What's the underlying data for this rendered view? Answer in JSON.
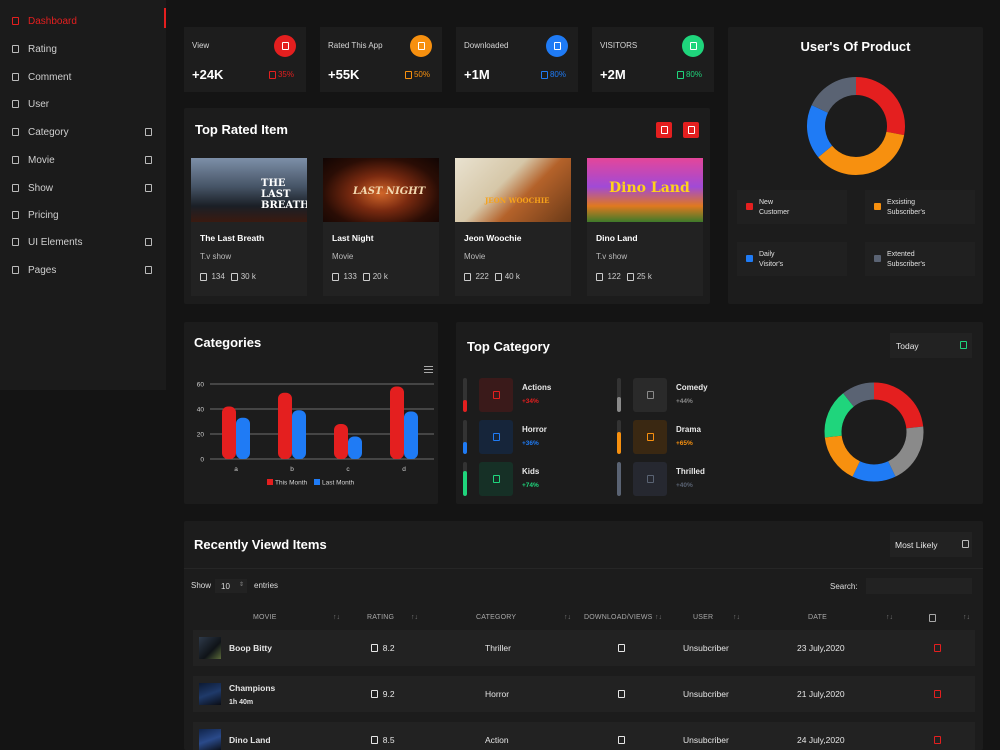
{
  "sidebar": {
    "items": [
      {
        "label": "Dashboard",
        "active": true,
        "arrow": false
      },
      {
        "label": "Rating",
        "arrow": false
      },
      {
        "label": "Comment",
        "arrow": false
      },
      {
        "label": "User",
        "arrow": false
      },
      {
        "label": "Category",
        "arrow": true
      },
      {
        "label": "Movie",
        "arrow": true
      },
      {
        "label": "Show",
        "arrow": true
      },
      {
        "label": "Pricing",
        "arrow": false
      },
      {
        "label": "UI Elements",
        "arrow": true
      },
      {
        "label": "Pages",
        "arrow": true
      }
    ]
  },
  "stats": [
    {
      "name": "View",
      "value": "+24K",
      "pct": "35%",
      "color": "#e41f1f"
    },
    {
      "name": "Rated This App",
      "value": "+55K",
      "pct": "50%",
      "color": "#f7900f"
    },
    {
      "name": "Downloaded",
      "value": "+1M",
      "pct": "80%",
      "color": "#1f7bf5"
    },
    {
      "name": "VISITORS",
      "value": "+2M",
      "pct": "80%",
      "color": "#1fd57c"
    }
  ],
  "top_rated": {
    "title": "Top Rated Item",
    "items": [
      {
        "title": "The Last Breath",
        "genre": "T.v show",
        "likes": "134",
        "views": "30 k",
        "poster_text": "THE LAST BREATH"
      },
      {
        "title": "Last Night",
        "genre": "Movie",
        "likes": "133",
        "views": "20 k",
        "poster_text": "LAST NIGHT"
      },
      {
        "title": "Jeon Woochie",
        "genre": "Movie",
        "likes": "222",
        "views": "40 k",
        "poster_text": "JEON WOOCHIE"
      },
      {
        "title": "Dino Land",
        "genre": "T.v show",
        "likes": "122",
        "views": "25 k",
        "poster_text": "Dino Land"
      }
    ]
  },
  "users_of_product": {
    "title": "User's Of Product",
    "legend": [
      {
        "line1": "New",
        "line2": "Customer",
        "color": "#e41f1f"
      },
      {
        "line1": "Exsisting",
        "line2": "Subscriber's",
        "color": "#f7900f"
      },
      {
        "line1": "Daily",
        "line2": "Visitor's",
        "color": "#1f7bf5"
      },
      {
        "line1": "Extented",
        "line2": "Subscriber's",
        "color": "#5a6373"
      }
    ]
  },
  "categories": {
    "title": "Categories"
  },
  "chart_data": [
    {
      "type": "bar",
      "categories": [
        "a",
        "b",
        "c",
        "d"
      ],
      "series": [
        {
          "name": "This Month",
          "values": [
            42,
            53,
            28,
            58
          ],
          "color": "#e41f1f"
        },
        {
          "name": "Last Month",
          "values": [
            33,
            39,
            18,
            38
          ],
          "color": "#1f7bf5"
        }
      ],
      "ylim": [
        0,
        60
      ],
      "yticks": [
        0,
        20,
        40,
        60
      ],
      "legend": "bottom",
      "grid": true
    },
    {
      "type": "pie",
      "labels": [
        "New Customer",
        "Exsisting Subscriber's",
        "Daily Visitor's",
        "Extented Subscriber's"
      ],
      "values": [
        28,
        36,
        18,
        18
      ],
      "colors": [
        "#e41f1f",
        "#f7900f",
        "#1f7bf5",
        "#5a6373"
      ]
    },
    {
      "type": "pie",
      "values": [
        26,
        22,
        16,
        18,
        18,
        12
      ],
      "colors": [
        "#e41f1f",
        "#8a8a8a",
        "#1f7bf5",
        "#f7900f",
        "#1fd57c",
        "#5a6373"
      ]
    }
  ],
  "top_category": {
    "title": "Top Category",
    "dropdown": "Today",
    "items": [
      {
        "name": "Actions",
        "pct": "+34%",
        "level": 0.34,
        "color": "#e41f1f",
        "bg": "#3a1a1a"
      },
      {
        "name": "Comedy",
        "pct": "+44%",
        "level": 0.44,
        "color": "#8a8a8a",
        "bg": "#2a2a2a"
      },
      {
        "name": "Horror",
        "pct": "+36%",
        "level": 0.36,
        "color": "#1f7bf5",
        "bg": "#16253a"
      },
      {
        "name": "Drama",
        "pct": "+65%",
        "level": 0.65,
        "color": "#f7900f",
        "bg": "#3a2812"
      },
      {
        "name": "Kids",
        "pct": "+74%",
        "level": 0.74,
        "color": "#1fd57c",
        "bg": "#163026"
      },
      {
        "name": "Thrilled",
        "pct": "+40%",
        "level": 0.4,
        "color": "#5a6373",
        "bg": "#262830"
      }
    ]
  },
  "recent": {
    "title": "Recently Viewd Items",
    "dropdown": "Most Likely",
    "show_label": "Show",
    "entries_value": "10",
    "entries_label": "entries",
    "search_label": "Search:",
    "headers": [
      "MOVIE",
      "RATING",
      "CATEGORY",
      "DOWNLOAD/VIEWS",
      "USER",
      "DATE"
    ],
    "rows": [
      {
        "movie": "Boop Bitty",
        "sub": "",
        "rating": "8.2",
        "category": "Thriller",
        "user": "Unsubcriber",
        "date": "23 July,2020"
      },
      {
        "movie": "Champions",
        "sub": "1h 40m",
        "rating": "9.2",
        "category": "Horror",
        "user": "Unsubcriber",
        "date": "21 July,2020"
      },
      {
        "movie": "Dino Land",
        "sub": "",
        "rating": "8.5",
        "category": "Action",
        "user": "Unsubcriber",
        "date": "24 July,2020"
      }
    ]
  }
}
